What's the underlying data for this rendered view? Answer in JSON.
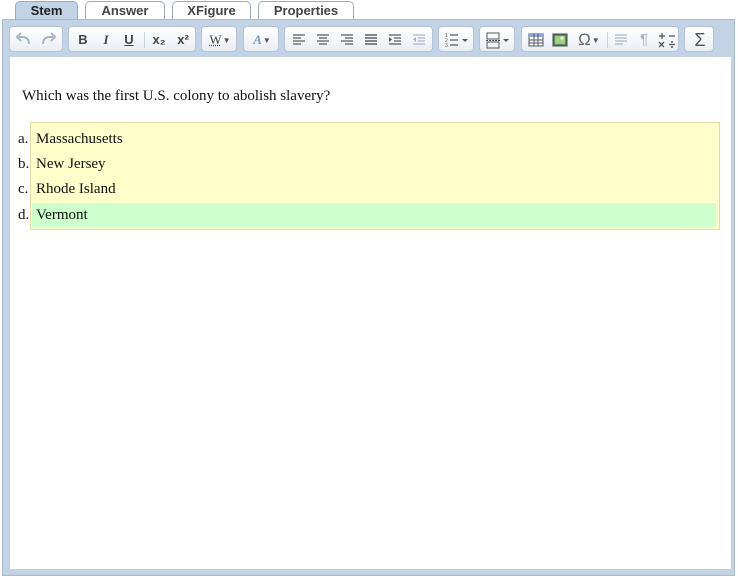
{
  "tabs": [
    {
      "label": "Stem",
      "active": true
    },
    {
      "label": "Answer",
      "active": false
    },
    {
      "label": "XFigure",
      "active": false
    },
    {
      "label": "Properties",
      "active": false
    }
  ],
  "toolbar": {
    "bold": "B",
    "italic": "I",
    "underline": "U",
    "subscript": "x₂",
    "superscript": "x²",
    "spellcheck": "W",
    "special_char": "Ω",
    "formula": "Σ",
    "pilcrow": "¶"
  },
  "question": {
    "stem": "Which was the first U.S. colony to abolish slavery?",
    "choices": [
      {
        "letter": "a.",
        "text": "Massachusetts",
        "correct": false
      },
      {
        "letter": "b.",
        "text": "New Jersey",
        "correct": false
      },
      {
        "letter": "c.",
        "text": "Rhode Island",
        "correct": false
      },
      {
        "letter": "d.",
        "text": "Vermont",
        "correct": true
      }
    ]
  },
  "colors": {
    "choices_bg": "#ffffcc",
    "correct_bg": "#ccffcc",
    "frame": "#c3d3e6"
  }
}
